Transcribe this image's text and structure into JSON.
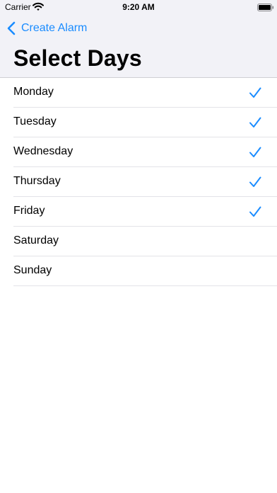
{
  "status_bar": {
    "carrier": "Carrier",
    "time": "9:20 AM"
  },
  "nav": {
    "back_label": "Create Alarm",
    "title": "Select Days"
  },
  "days": [
    {
      "label": "Monday",
      "checked": true
    },
    {
      "label": "Tuesday",
      "checked": true
    },
    {
      "label": "Wednesday",
      "checked": true
    },
    {
      "label": "Thursday",
      "checked": true
    },
    {
      "label": "Friday",
      "checked": true
    },
    {
      "label": "Saturday",
      "checked": false
    },
    {
      "label": "Sunday",
      "checked": false
    }
  ],
  "colors": {
    "accent": "#1a8cff",
    "header_bg": "#f2f2f7",
    "separator": "#e3e3e8"
  },
  "icons": {
    "wifi": "wifi-icon",
    "battery": "battery-icon",
    "back": "chevron-left-icon",
    "check": "checkmark-icon"
  }
}
